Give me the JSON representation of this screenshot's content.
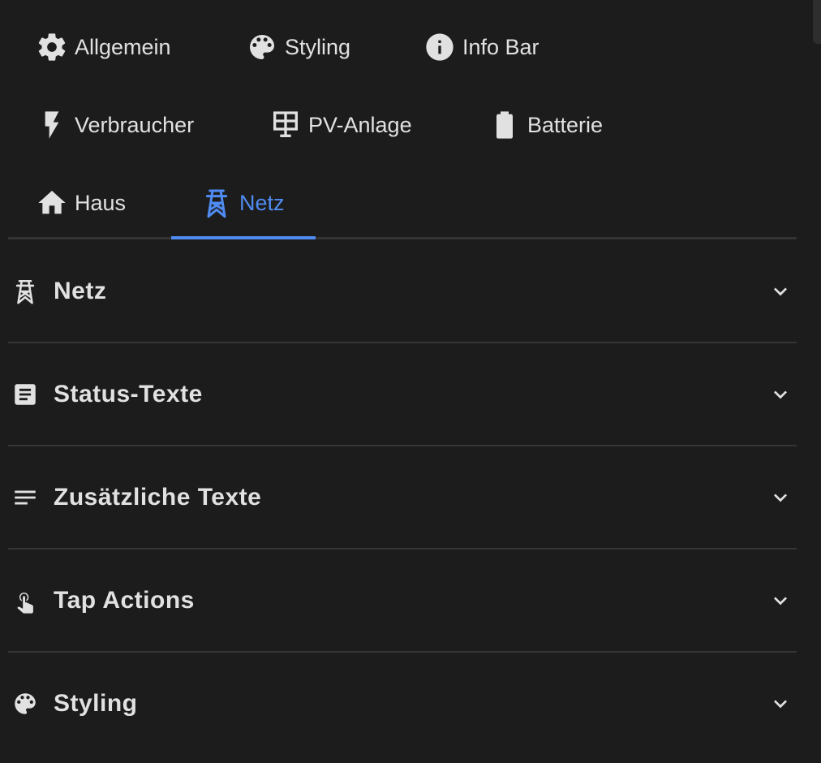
{
  "tabs": [
    {
      "label": "Allgemein",
      "icon": "gear-icon"
    },
    {
      "label": "Styling",
      "icon": "palette-icon"
    },
    {
      "label": "Info Bar",
      "icon": "info-icon"
    },
    {
      "label": "Verbraucher",
      "icon": "lightning-icon"
    },
    {
      "label": "PV-Anlage",
      "icon": "solar-panel-icon"
    },
    {
      "label": "Batterie",
      "icon": "battery-icon"
    },
    {
      "label": "Haus",
      "icon": "home-icon"
    },
    {
      "label": "Netz",
      "icon": "transmission-tower-icon",
      "active": true
    }
  ],
  "sections": [
    {
      "title": "Netz",
      "icon": "transmission-tower-icon"
    },
    {
      "title": "Status-Texte",
      "icon": "text-box-icon"
    },
    {
      "title": "Zusätzliche Texte",
      "icon": "text-lines-icon"
    },
    {
      "title": "Tap Actions",
      "icon": "gesture-tap-icon"
    },
    {
      "title": "Styling",
      "icon": "palette-icon"
    }
  ],
  "colors": {
    "accent": "#4f8bf0",
    "background": "#1c1c1c",
    "text": "#e1e1e1",
    "divider": "#353535"
  }
}
